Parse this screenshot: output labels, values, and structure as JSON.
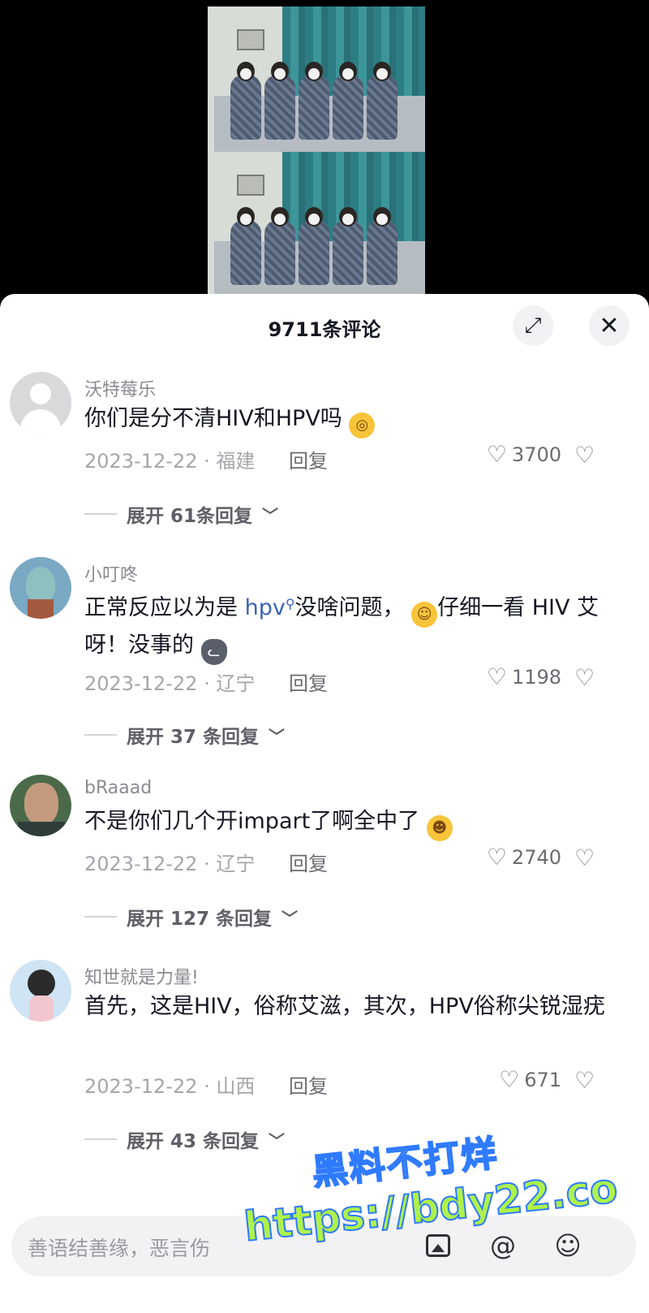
{
  "header": {
    "title": "9711条评论"
  },
  "comments": [
    {
      "user": "沃特莓乐",
      "text": "你们是分不清HIV和HPV吗",
      "date_loc": "2023-12-22 · 福建",
      "reply_label": "回复",
      "likes": "3700",
      "expand_label": "展开 61条回复"
    },
    {
      "user": "小叮咚",
      "text_a": "正常反应以为是 ",
      "text_kw": "hpv",
      "text_b": "没啥问题，",
      "text_c": "仔细一看 HIV 艾呀！没事的",
      "date_loc": "2023-12-22 · 辽宁",
      "reply_label": "回复",
      "likes": "1198",
      "expand_label": "展开 37 条回复"
    },
    {
      "user": "bRaaad",
      "text": "不是你们几个开impart了啊全中了",
      "date_loc": "2023-12-22 · 辽宁",
      "reply_label": "回复",
      "likes": "2740",
      "expand_label": "展开 127 条回复"
    },
    {
      "user": "知世就是力量!",
      "text": "首先，这是HIV，俗称艾滋，其次，HPV俗称尖锐湿疣",
      "date_loc": "2023-12-22 · 山西",
      "reply_label": "回复",
      "likes": "671",
      "expand_label": "展开 43 条回复"
    }
  ],
  "input": {
    "placeholder": "善语结善缘，恶言伤"
  },
  "watermark": {
    "line1": "黑料不打烊",
    "line2": "https://bdy22.co"
  },
  "icons": {
    "expand": "expand-icon",
    "close": "close-icon",
    "like": "heart-icon",
    "dislike": "broken-heart-icon",
    "image": "image-icon",
    "mention": "at-icon",
    "emoji": "emoji-icon"
  }
}
